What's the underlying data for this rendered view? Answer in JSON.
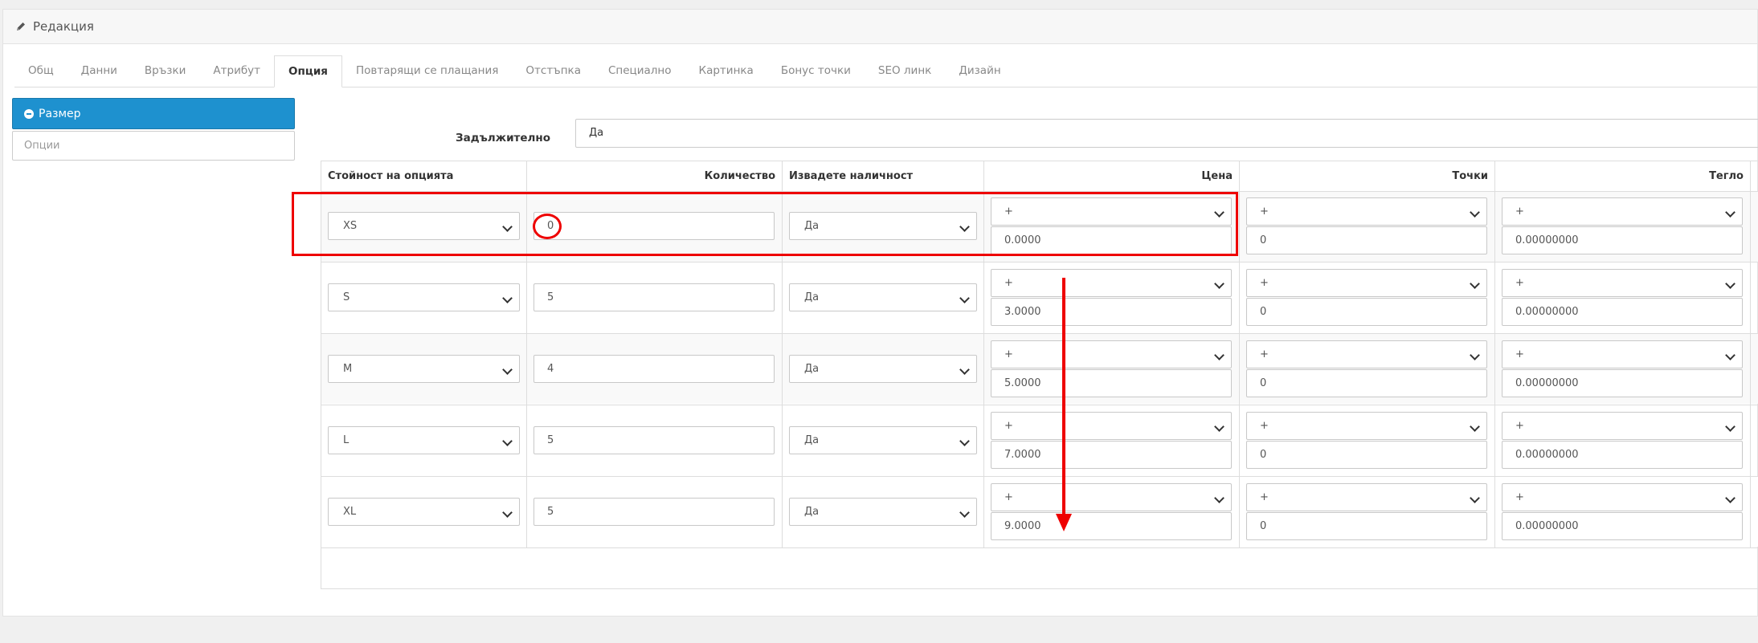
{
  "panel": {
    "title": "Редакция",
    "title_icon": "pencil-icon"
  },
  "tabs": [
    {
      "label": "Общ"
    },
    {
      "label": "Данни"
    },
    {
      "label": "Връзки"
    },
    {
      "label": "Атрибут"
    },
    {
      "label": "Опция",
      "active": true
    },
    {
      "label": "Повтарящи се плащания"
    },
    {
      "label": "Отстъпка"
    },
    {
      "label": "Специално"
    },
    {
      "label": "Картинка"
    },
    {
      "label": "Бонус точки"
    },
    {
      "label": "SEO линк"
    },
    {
      "label": "Дизайн"
    }
  ],
  "sidebar": {
    "option_button": "Размер",
    "option_button_icon": "minus-circle-icon",
    "options_placeholder": "Опции"
  },
  "required": {
    "label": "Задължително",
    "value": "Да"
  },
  "table": {
    "headers": {
      "option_value": "Стойност на опцията",
      "quantity": "Количество",
      "subtract": "Извадете наличност",
      "price": "Цена",
      "points": "Точки",
      "weight": "Тегло"
    },
    "rows": [
      {
        "option": "XS",
        "quantity": "0",
        "subtract": "Да",
        "price_prefix": "+",
        "price": "0.0000",
        "points_prefix": "+",
        "points": "0",
        "weight_prefix": "+",
        "weight": "0.00000000"
      },
      {
        "option": "S",
        "quantity": "5",
        "subtract": "Да",
        "price_prefix": "+",
        "price": "3.0000",
        "points_prefix": "+",
        "points": "0",
        "weight_prefix": "+",
        "weight": "0.00000000"
      },
      {
        "option": "M",
        "quantity": "4",
        "subtract": "Да",
        "price_prefix": "+",
        "price": "5.0000",
        "points_prefix": "+",
        "points": "0",
        "weight_prefix": "+",
        "weight": "0.00000000"
      },
      {
        "option": "L",
        "quantity": "5",
        "subtract": "Да",
        "price_prefix": "+",
        "price": "7.0000",
        "points_prefix": "+",
        "points": "0",
        "weight_prefix": "+",
        "weight": "0.00000000"
      },
      {
        "option": "XL",
        "quantity": "5",
        "subtract": "Да",
        "price_prefix": "+",
        "price": "9.0000",
        "points_prefix": "+",
        "points": "0",
        "weight_prefix": "+",
        "weight": "0.00000000"
      }
    ]
  },
  "colors": {
    "primary": "#1e91cf",
    "annotation": "#e00000"
  }
}
